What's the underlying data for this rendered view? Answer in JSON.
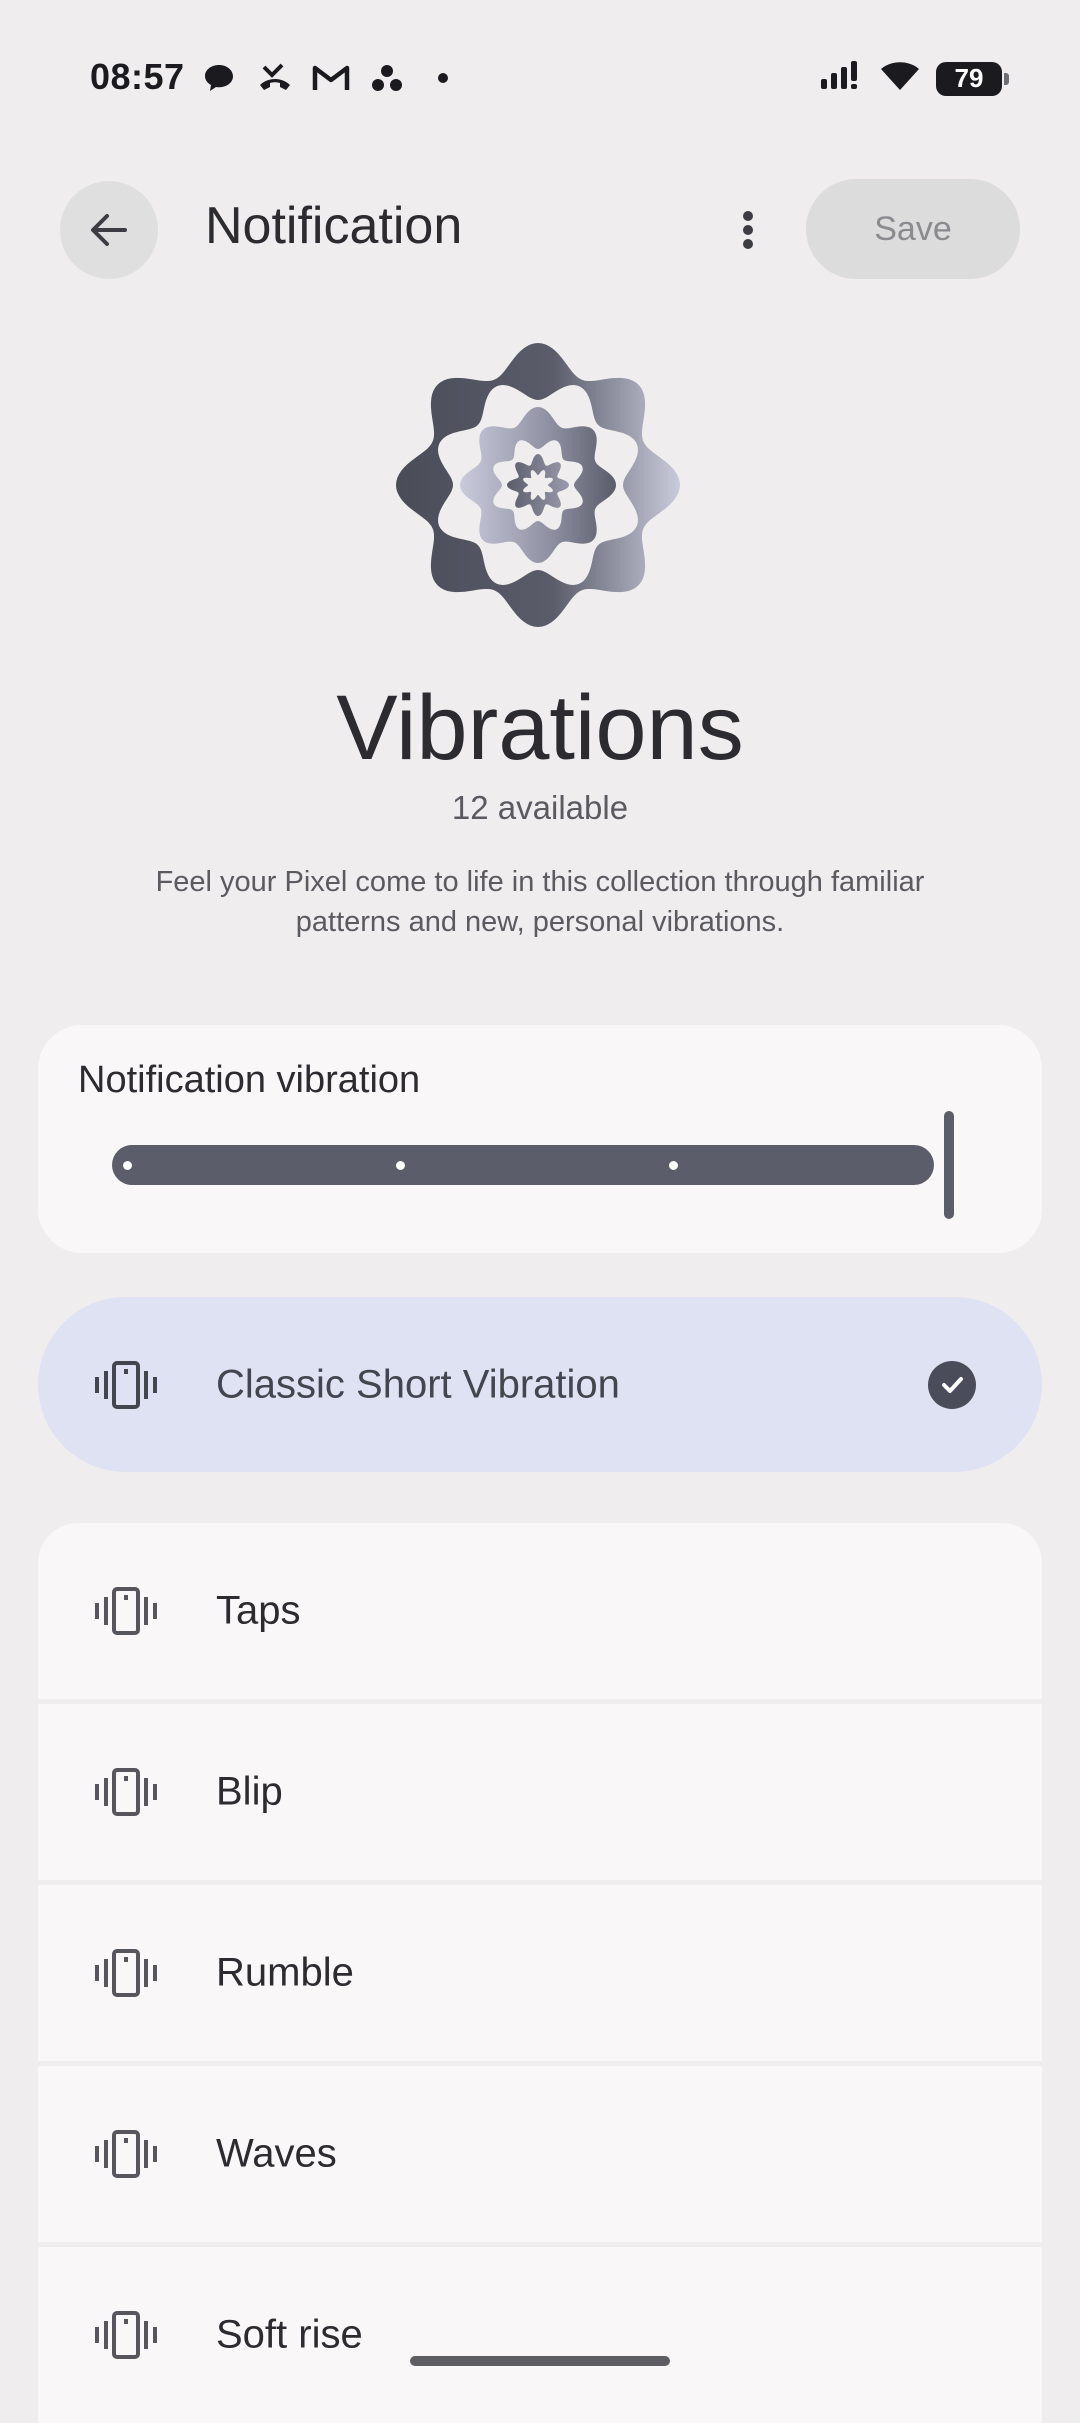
{
  "status_bar": {
    "time": "08:57",
    "notification_icons": [
      "chat-bubble-icon",
      "missed-call-icon",
      "gmail-icon",
      "three-dots-cluster-icon",
      "dot-icon"
    ],
    "signal_icon": "signal-icon",
    "wifi_icon": "wifi-icon",
    "battery": "79"
  },
  "app_bar": {
    "back_icon": "arrow-back-icon",
    "title": "Notification",
    "more_icon": "more-vert-icon",
    "save_label": "Save"
  },
  "hero": {
    "icon": "vibration-flower-icon",
    "title": "Vibrations",
    "count": "12 available",
    "description": "Feel your Pixel come to life in this collection through familiar patterns and new, personal vibrations."
  },
  "intensity": {
    "label": "Notification vibration",
    "level": 1.0
  },
  "selected_option": {
    "label": "Classic Short Vibration",
    "icon": "vibration-icon",
    "check_icon": "check-circle-icon"
  },
  "options": [
    {
      "label": "Taps",
      "icon": "vibration-icon"
    },
    {
      "label": "Blip",
      "icon": "vibration-icon"
    },
    {
      "label": "Rumble",
      "icon": "vibration-icon"
    },
    {
      "label": "Waves",
      "icon": "vibration-icon"
    },
    {
      "label": "Soft rise",
      "icon": "vibration-icon"
    }
  ],
  "colors": {
    "background": "#efeded",
    "card": "#faf7f8",
    "selected": "#dfe2f2",
    "accent": "#5b5d6b"
  }
}
